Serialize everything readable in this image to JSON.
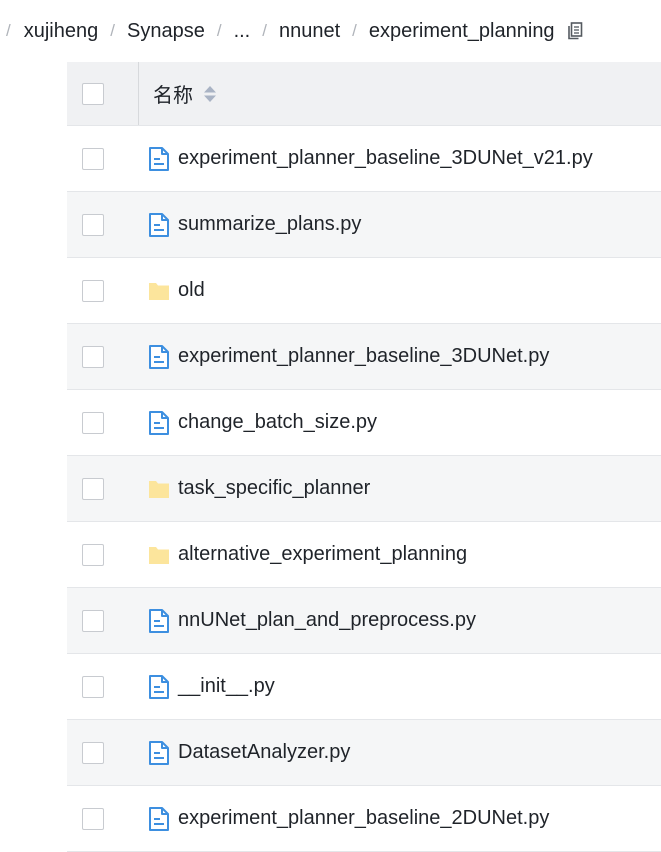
{
  "breadcrumb": {
    "items": [
      "xujiheng",
      "Synapse",
      "...",
      "nnunet",
      "experiment_planning"
    ],
    "separator": "/"
  },
  "table": {
    "header": {
      "name_label": "名称"
    },
    "rows": [
      {
        "name": "experiment_planner_baseline_3DUNet_v21.py",
        "type": "file"
      },
      {
        "name": "summarize_plans.py",
        "type": "file"
      },
      {
        "name": "old",
        "type": "folder"
      },
      {
        "name": "experiment_planner_baseline_3DUNet.py",
        "type": "file"
      },
      {
        "name": "change_batch_size.py",
        "type": "file"
      },
      {
        "name": "task_specific_planner",
        "type": "folder"
      },
      {
        "name": "alternative_experiment_planning",
        "type": "folder"
      },
      {
        "name": "nnUNet_plan_and_preprocess.py",
        "type": "file"
      },
      {
        "name": "__init__.py",
        "type": "file"
      },
      {
        "name": "DatasetAnalyzer.py",
        "type": "file"
      },
      {
        "name": "experiment_planner_baseline_2DUNet.py",
        "type": "file"
      }
    ]
  },
  "colors": {
    "file_icon": "#3d8fe0",
    "folder_icon": "#fce59c",
    "header_bg": "#f0f1f3",
    "alt_row_bg": "#f5f6f7"
  },
  "icons": {
    "copy": "copy-icon",
    "sort": "sort-icon",
    "file": "file-icon",
    "folder": "folder-icon"
  }
}
